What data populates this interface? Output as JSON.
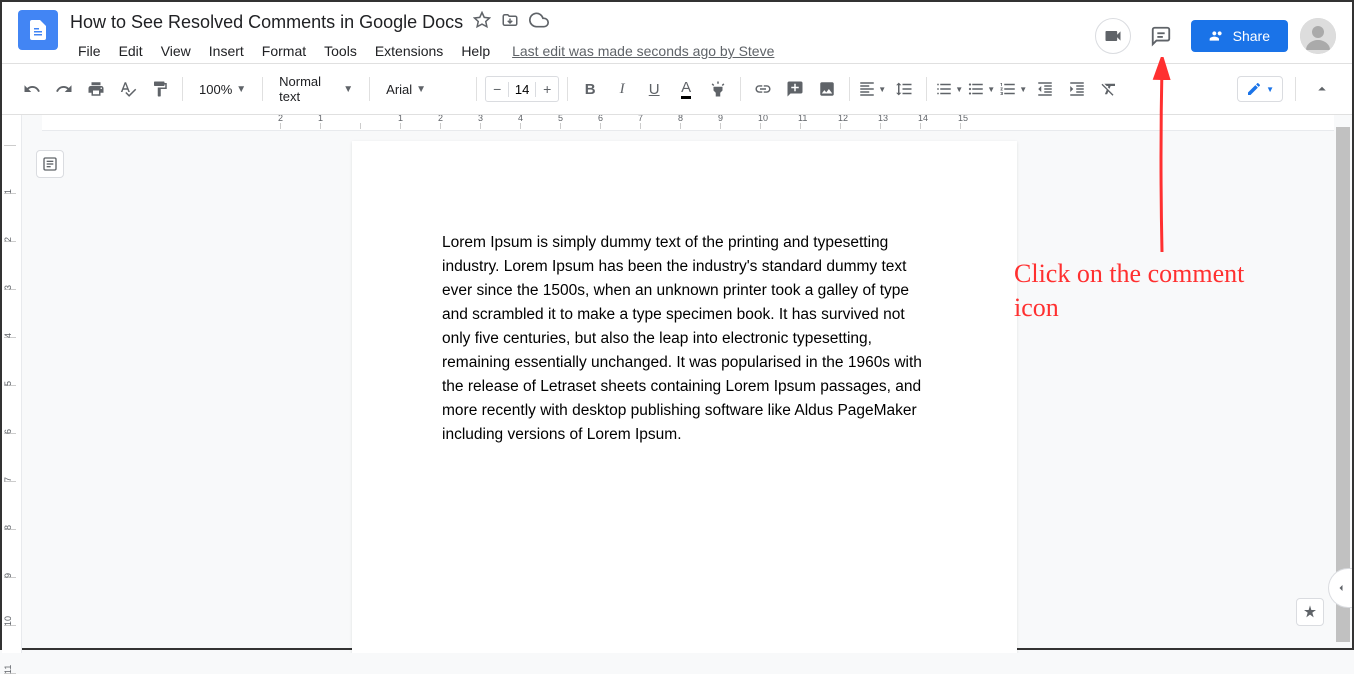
{
  "header": {
    "title": "How to See Resolved Comments in Google Docs",
    "menus": [
      "File",
      "Edit",
      "View",
      "Insert",
      "Format",
      "Tools",
      "Extensions",
      "Help"
    ],
    "last_edit": "Last edit was made seconds ago by Steve",
    "share_label": "Share"
  },
  "toolbar": {
    "zoom": "100%",
    "style": "Normal text",
    "font": "Arial",
    "font_size": "14"
  },
  "document": {
    "body": "Lorem Ipsum is simply dummy text of the printing and typesetting industry. Lorem Ipsum has been the industry's standard dummy text ever since the 1500s, when an unknown printer took a galley of type and scrambled it to make a type specimen book. It has survived not only five centuries, but also the leap into electronic typesetting, remaining essentially unchanged. It was popularised in the 1960s with the release of Letraset sheets containing Lorem Ipsum passages, and more recently with desktop publishing software like Aldus PageMaker including versions of Lorem Ipsum."
  },
  "annotation": {
    "text": "Click on the comment icon"
  },
  "ruler_h": [
    2,
    1,
    "",
    1,
    2,
    3,
    4,
    5,
    6,
    7,
    8,
    9,
    10,
    11,
    12,
    13,
    14,
    15
  ],
  "ruler_v": [
    "",
    1,
    2,
    3,
    4,
    5,
    6,
    7,
    8,
    9,
    10,
    11
  ]
}
